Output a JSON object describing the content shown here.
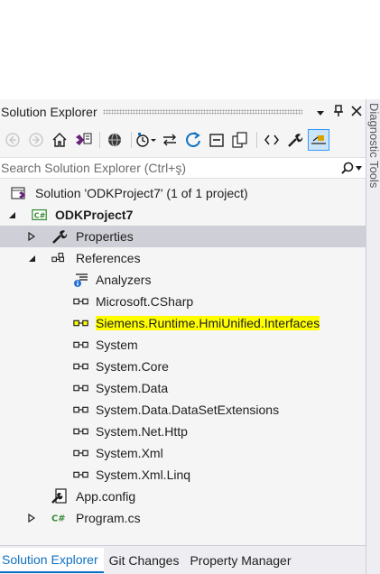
{
  "panel": {
    "title": "Solution Explorer",
    "side_strip_label": "Diagnostic Tools"
  },
  "search": {
    "placeholder": "Search Solution Explorer (Ctrl+ş)"
  },
  "tree": {
    "solution": "Solution 'ODKProject7' (1 of 1 project)",
    "project": "ODKProject7",
    "properties": "Properties",
    "references": "References",
    "refs": [
      "Analyzers",
      "Microsoft.CSharp",
      "Siemens.Runtime.HmiUnified.Interfaces",
      "System",
      "System.Core",
      "System.Data",
      "System.Data.DataSetExtensions",
      "System.Net.Http",
      "System.Xml",
      "System.Xml.Linq"
    ],
    "app_config": "App.config",
    "program": "Program.cs"
  },
  "tabs": [
    "Solution Explorer",
    "Git Changes",
    "Property Manager"
  ],
  "colors": {
    "highlight": "#ffff00",
    "accent": "#0e70c0",
    "selection": "#cfcfd7"
  }
}
